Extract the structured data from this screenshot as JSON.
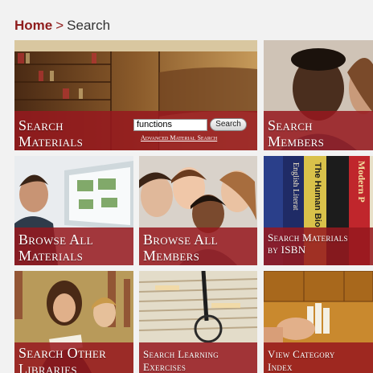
{
  "breadcrumb": {
    "home": "Home",
    "separator": ">",
    "current": "Search"
  },
  "search_materials": {
    "title_line1": "Search",
    "title_line2": "Materials",
    "input_value": "functions",
    "button_label": "Search",
    "advanced_link": "Advanced Material Search"
  },
  "tiles": {
    "search_members": {
      "line1": "Search",
      "line2": "Members"
    },
    "browse_materials": {
      "line1": "Browse All",
      "line2": "Materials"
    },
    "browse_members": {
      "line1": "Browse All",
      "line2": "Members"
    },
    "search_isbn": {
      "line1": "Search Materials",
      "line2": "by ISBN"
    },
    "search_libraries": {
      "line1": "Search Other",
      "line2": "Libraries"
    },
    "search_exercises": {
      "line1": "Search Learning",
      "line2": "Exercises"
    },
    "category_index": {
      "line1": "View Category",
      "line2": "Index"
    }
  },
  "colors": {
    "brand": "#8f1d1d",
    "band": "#96191e",
    "background": "#f2f2f2"
  },
  "spines": [
    "English Literat",
    "The Human Bio",
    "Modern P"
  ]
}
